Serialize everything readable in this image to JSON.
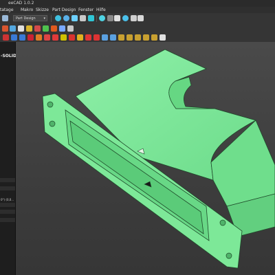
{
  "window": {
    "title": "eeCAD 1.0.2"
  },
  "menu": {
    "items": [
      "tatage",
      "Makro",
      "Skizze",
      "Part Design",
      "Fenster",
      "Hilfe"
    ]
  },
  "toolbar": {
    "workbench_selected": "Part Design"
  },
  "panel": {
    "title": "-SOLID",
    "property_value": "0°) (0,0..."
  },
  "icons": [
    "open-icon",
    "save-icon",
    "cut-icon",
    "paste-icon",
    "undo-icon",
    "redo-icon",
    "refresh-icon",
    "zoom-fit-icon",
    "zoom-in-icon",
    "view-front-icon",
    "view-dropdown-icon",
    "measure-icon",
    "sketch-icon",
    "pad-icon",
    "pocket-icon",
    "fillet-icon",
    "chamfer-icon",
    "mirror-icon"
  ],
  "colors": {
    "model": "#7fe69a",
    "model_dark": "#5ac777",
    "edge": "#1a3a22"
  }
}
